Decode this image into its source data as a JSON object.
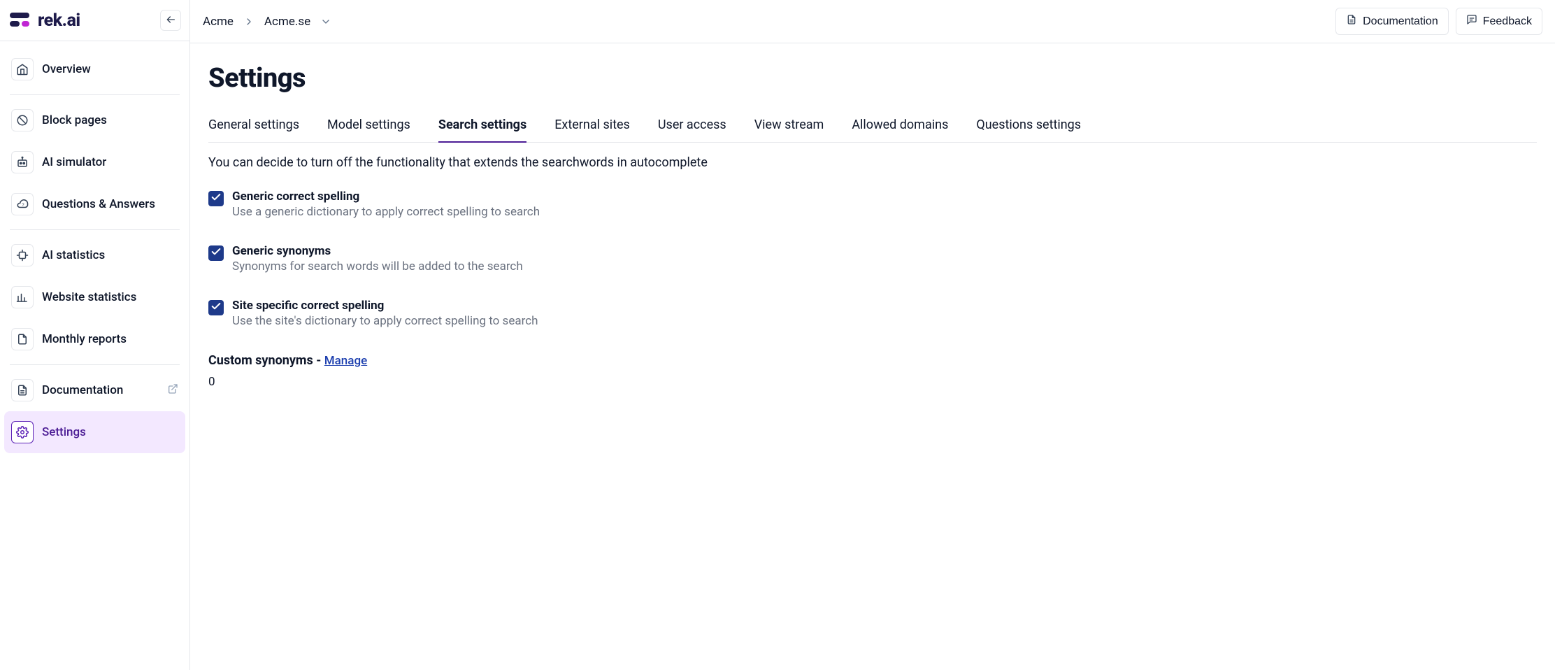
{
  "brand": {
    "text": "rek.ai"
  },
  "sidebar": {
    "items": [
      {
        "label": "Overview"
      },
      {
        "label": "Block pages"
      },
      {
        "label": "AI simulator"
      },
      {
        "label": "Questions & Answers"
      },
      {
        "label": "AI statistics"
      },
      {
        "label": "Website statistics"
      },
      {
        "label": "Monthly reports"
      },
      {
        "label": "Documentation"
      },
      {
        "label": "Settings"
      }
    ]
  },
  "breadcrumb": {
    "org": "Acme",
    "site": "Acme.se"
  },
  "topbar": {
    "documentation": "Documentation",
    "feedback": "Feedback"
  },
  "page": {
    "title": "Settings"
  },
  "tabs": [
    "General settings",
    "Model settings",
    "Search settings",
    "External sites",
    "User access",
    "View stream",
    "Allowed domains",
    "Questions settings"
  ],
  "tab_description": "You can decide to turn off the functionality that extends the searchwords in autocomplete",
  "checks": [
    {
      "title": "Generic correct spelling",
      "desc": "Use a generic dictionary to apply correct spelling to search"
    },
    {
      "title": "Generic synonyms",
      "desc": "Synonyms for search words will be added to the search"
    },
    {
      "title": "Site specific correct spelling",
      "desc": "Use the site's dictionary to apply correct spelling to search"
    }
  ],
  "custom_synonyms": {
    "label": "Custom synonyms",
    "separator": " - ",
    "manage": "Manage",
    "count": "0"
  }
}
